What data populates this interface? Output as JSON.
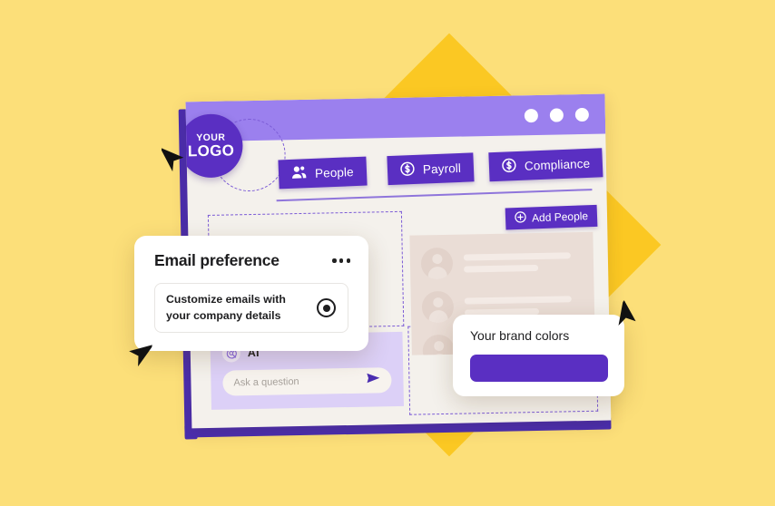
{
  "theme": {
    "background": "#FCDF79",
    "accent_diamond": "#FBC823",
    "brand_purple": "#5A2FC2",
    "titlebar_purple": "#9B80EE",
    "window_bg": "#F4F1EC",
    "ai_panel": "#DCD0F7",
    "people_panel": "#EADDD6",
    "dashed_outline": "#7B5BD6"
  },
  "window": {
    "titlebar": {
      "dots": [
        "window-dot-1",
        "window-dot-2",
        "window-dot-3"
      ]
    },
    "logo": {
      "line1": "YOUR",
      "line2": "LOGO"
    },
    "nav": {
      "tabs": [
        {
          "label": "People",
          "icon": "people-icon"
        },
        {
          "label": "Payroll",
          "icon": "dollar-circle-icon"
        },
        {
          "label": "Compliance",
          "icon": "dollar-circle-icon"
        }
      ]
    },
    "toolbar": {
      "add_people_label": "Add People",
      "add_people_icon": "plus-circle-icon"
    },
    "people_list": {
      "rows": [
        {
          "avatar": "avatar-placeholder"
        },
        {
          "avatar": "avatar-placeholder"
        },
        {
          "avatar": "avatar-placeholder"
        }
      ]
    },
    "ai": {
      "title": "AI",
      "icon": "ai-sparkle-icon",
      "input_placeholder": "Ask a question",
      "send_icon": "send-arrow-icon",
      "input_value": ""
    }
  },
  "cards": {
    "email_preference": {
      "title": "Email preference",
      "menu_icon": "more-options-icon",
      "option_label": "Customize emails with your company details",
      "option_selected": true
    },
    "brand_colors": {
      "title": "Your brand colors",
      "swatch_color": "#5A2FC2"
    }
  },
  "cursors": [
    {
      "name": "cursor-pointer-logo"
    },
    {
      "name": "cursor-pointer-email-card"
    },
    {
      "name": "cursor-pointer-brand-card"
    }
  ]
}
